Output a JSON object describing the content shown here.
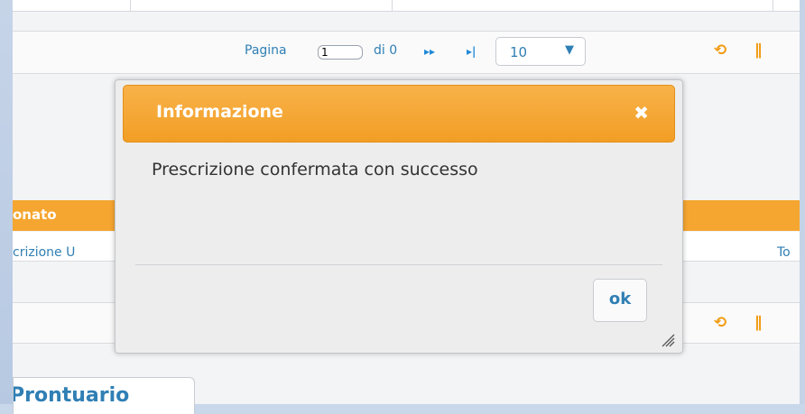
{
  "pager": {
    "page_label": "Pagina",
    "page_value": "1",
    "of_label": "di 0",
    "next_icon": "next-page-icon",
    "last_icon": "last-page-icon",
    "page_size": "10",
    "refresh_icon": "refresh-icon",
    "columns_icon": "columns-icon"
  },
  "table": {
    "header": "onato",
    "row_cell_1": "crizione U",
    "row_cell_2": "To"
  },
  "tab": {
    "label": "Prontuario"
  },
  "dialog": {
    "title": "Informazione",
    "close_symbol": "✖",
    "message": "Prescrizione confermata con successo",
    "ok_label": "ok"
  },
  "colors": {
    "accent": "#f29e25",
    "link": "#2f7fb4",
    "background": "#f3f4f6"
  }
}
